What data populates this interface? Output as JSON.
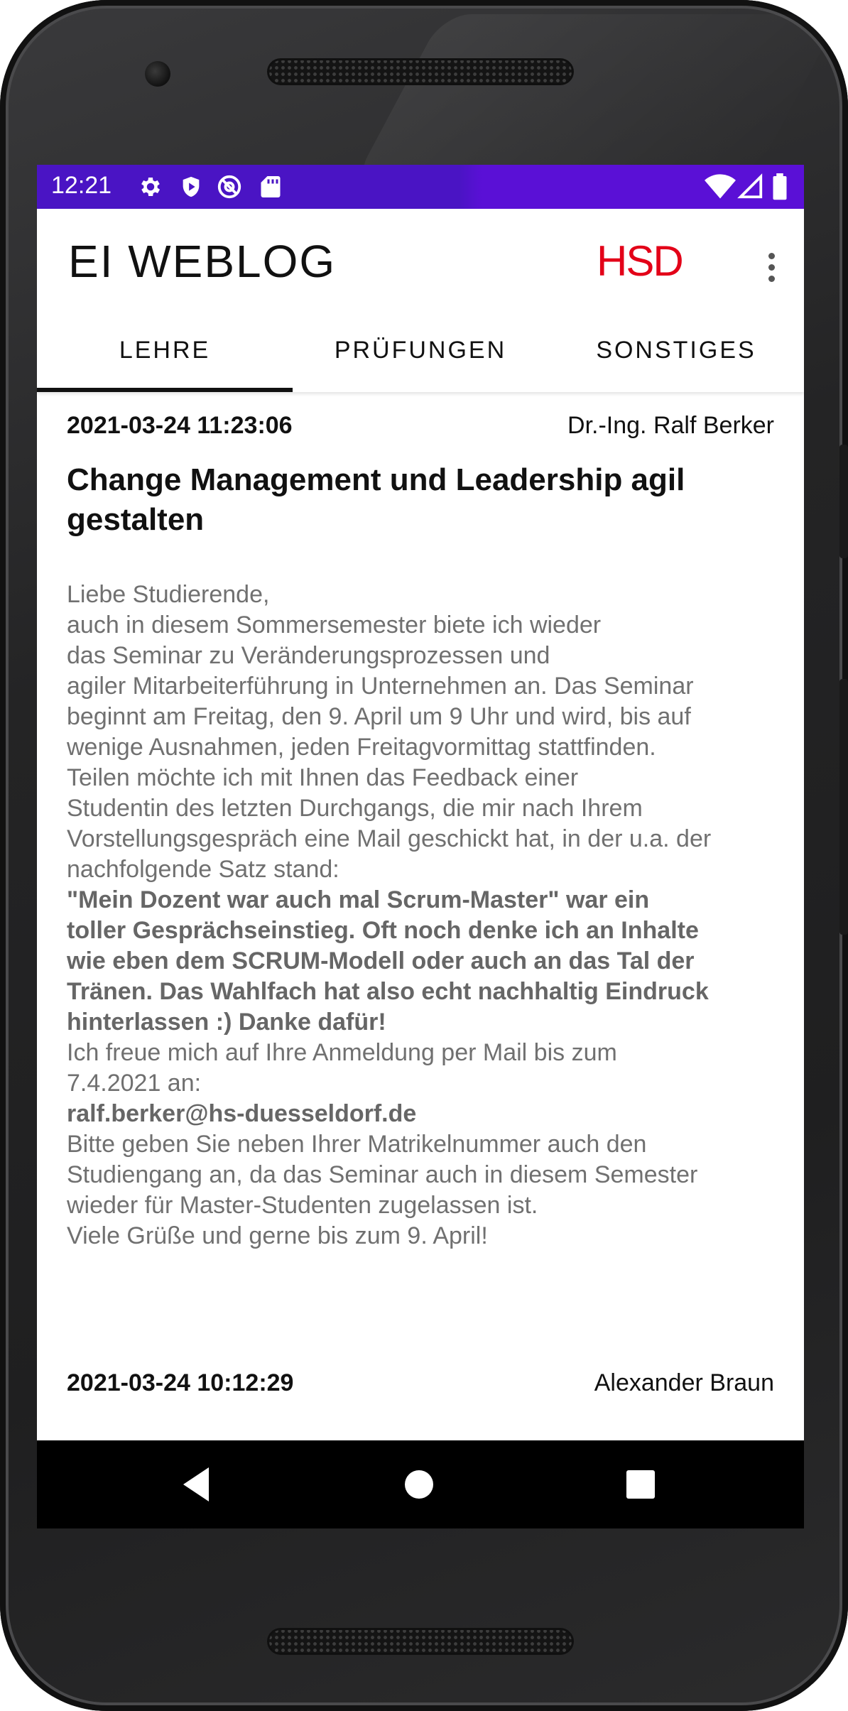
{
  "status_bar": {
    "time": "12:21",
    "left_icons": [
      "gear-icon",
      "shield-icon",
      "no-disturb-icon",
      "sd-card-icon"
    ],
    "right_icons": [
      "wifi-icon",
      "signal-icon",
      "battery-icon"
    ],
    "color": "#4a14c4"
  },
  "app_bar": {
    "logo_text": "EI WEBLOG",
    "brand_text": "HSD",
    "brand_color": "#e30018",
    "menu_icon": "more-vert-icon"
  },
  "tabs": [
    {
      "label": "LEHRE",
      "selected": true
    },
    {
      "label": "PRÜFUNGEN",
      "selected": false
    },
    {
      "label": "SONSTIGES",
      "selected": false
    }
  ],
  "posts": [
    {
      "date": "2021-03-24 11:23:06",
      "author": "Dr.-Ing. Ralf Berker",
      "title_lines": [
        "Change Management und Leadership agil",
        "gestalten"
      ],
      "body_lines": [
        {
          "text": "Liebe Studierende,",
          "bold": false
        },
        {
          "text": "auch in diesem Sommersemester biete ich wieder",
          "bold": false
        },
        {
          "text": "das Seminar zu Veränderungsprozessen und",
          "bold": false
        },
        {
          "text": "agiler Mitarbeiterführung in Unternehmen an. Das Seminar",
          "bold": false
        },
        {
          "text": "beginnt am Freitag, den 9. April um 9 Uhr und wird, bis auf",
          "bold": false
        },
        {
          "text": "wenige Ausnahmen, jeden Freitagvormittag stattfinden.",
          "bold": false
        },
        {
          "text": "Teilen möchte ich mit Ihnen das Feedback einer",
          "bold": false
        },
        {
          "text": "Studentin des letzten Durchgangs, die mir nach Ihrem",
          "bold": false
        },
        {
          "text": "Vorstellungsgespräch eine Mail geschickt hat, in der u.a. der",
          "bold": false
        },
        {
          "text": "nachfolgende Satz stand:",
          "bold": false
        },
        {
          "text": "\"Mein Dozent war auch mal Scrum-Master\" war ein",
          "bold": true
        },
        {
          "text": "toller Gesprächseinstieg. Oft noch denke ich an Inhalte",
          "bold": true
        },
        {
          "text": "wie eben dem SCRUM-Modell oder auch an das Tal der",
          "bold": true
        },
        {
          "text": "Tränen. Das Wahlfach hat also echt nachhaltig Eindruck",
          "bold": true
        },
        {
          "text": "hinterlassen :) Danke dafür!",
          "bold": true
        },
        {
          "text": "Ich freue mich auf Ihre Anmeldung per Mail bis zum",
          "bold": false
        },
        {
          "text": "7.4.2021 an:",
          "bold": false
        },
        {
          "text": "ralf.berker@hs-duesseldorf.de",
          "bold": true
        },
        {
          "text": "Bitte geben Sie neben Ihrer Matrikelnummer auch den",
          "bold": false
        },
        {
          "text": "Studiengang an, da das Seminar auch in diesem Semester",
          "bold": false
        },
        {
          "text": "wieder für Master-Studenten zugelassen ist.",
          "bold": false
        },
        {
          "text": "Viele Grüße und gerne bis zum 9. April!",
          "bold": false
        }
      ]
    },
    {
      "date": "2021-03-24 10:12:29",
      "author": "Alexander Braun"
    }
  ],
  "nav_bar": {
    "icons": [
      "back-icon",
      "home-icon",
      "recents-icon"
    ]
  }
}
